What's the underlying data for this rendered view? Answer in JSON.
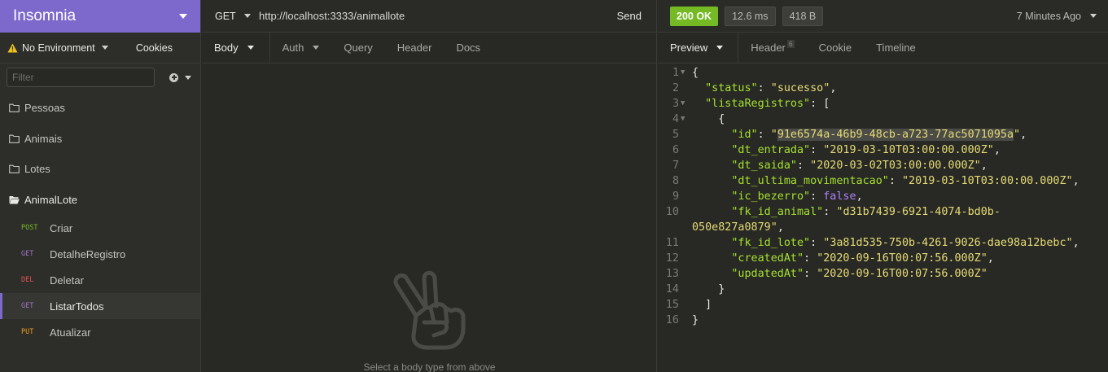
{
  "app": {
    "title": "Insomnia"
  },
  "sidebar": {
    "environment": "No Environment",
    "cookies": "Cookies",
    "filter_placeholder": "Filter",
    "folders": [
      {
        "label": "Pessoas"
      },
      {
        "label": "Animais"
      },
      {
        "label": "Lotes"
      },
      {
        "label": "AnimalLote"
      }
    ],
    "requests": [
      {
        "method": "POST",
        "label": "Criar",
        "color": "#75ba24"
      },
      {
        "method": "GET",
        "label": "DetalheRegistro",
        "color": "#a074c4"
      },
      {
        "method": "DEL",
        "label": "Deletar",
        "color": "#e15251"
      },
      {
        "method": "GET",
        "label": "ListarTodos",
        "color": "#a074c4"
      },
      {
        "method": "PUT",
        "label": "Atualizar",
        "color": "#ee9b1f"
      }
    ]
  },
  "request": {
    "method": "GET",
    "url": "http://localhost:3333/animallote",
    "send_label": "Send",
    "tabs": [
      "Body",
      "Auth",
      "Query",
      "Header",
      "Docs"
    ],
    "empty_message": "Select a body type from above"
  },
  "response": {
    "status": "200 OK",
    "time": "12.6 ms",
    "size": "418 B",
    "time_ago": "7 Minutes Ago",
    "tabs": [
      "Preview",
      "Header",
      "Cookie",
      "Timeline"
    ],
    "header_count": "6",
    "body": {
      "status": "sucesso",
      "item": {
        "id": "91e6574a-46b9-48cb-a723-77ac5071095a",
        "dt_entrada": "2019-03-10T03:00:00.000Z",
        "dt_saida": "2020-03-02T03:00:00.000Z",
        "dt_ultima_movimentacao": "2019-03-10T03:00:00.000Z",
        "ic_bezerro": "false",
        "fk_id_animal_part1": "d31b7439-6921-4074-bd0b-",
        "fk_id_animal_part2": "050e827a0879",
        "fk_id_lote": "3a81d535-750b-4261-9026-dae98a12bebc",
        "createdAt": "2020-09-16T00:07:56.000Z",
        "updatedAt": "2020-09-16T00:07:56.000Z"
      }
    }
  }
}
